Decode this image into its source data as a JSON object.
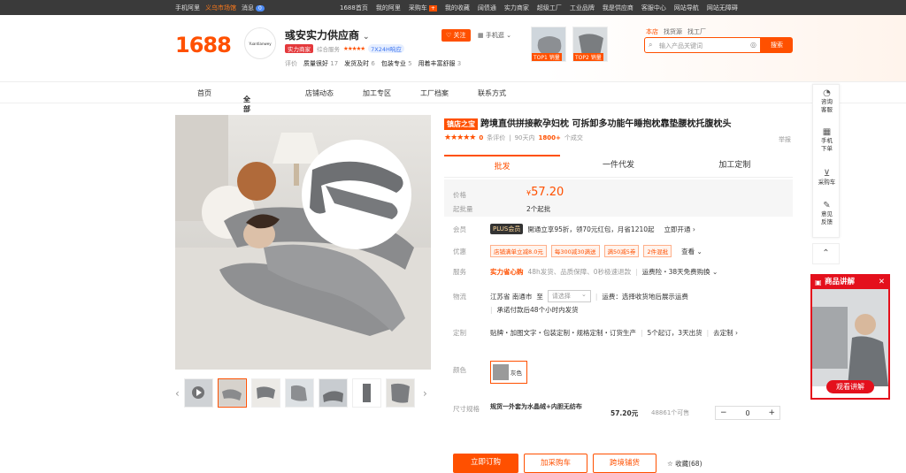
{
  "topbar": {
    "mobile": "手机阿里",
    "market": "义乌市场馆",
    "message": "消息",
    "msg_count": "0",
    "links": [
      "1688首页",
      "我的阿里",
      "采购车",
      "我的收藏",
      "阔债通",
      "实力商家",
      "超级工厂",
      "工业品牌",
      "我是供应商",
      "客服中心",
      "网站导航",
      "网站无障碍"
    ],
    "cart_badge": "+"
  },
  "header": {
    "logo": "1688",
    "shop_logo_text": "Yuantianwey",
    "shop_name": "彧安实力供应商",
    "tag_strength": "实力商家",
    "tag_service": "综合服务",
    "stars": "★★★★★",
    "tag_24h": "7X24H响应",
    "rating_label": "评价",
    "ratings": [
      {
        "label": "质量很好",
        "value": "17"
      },
      {
        "label": "发货及时",
        "value": "6"
      },
      {
        "label": "包装专业",
        "value": "5"
      },
      {
        "label": "用着丰富舒服",
        "value": "3"
      }
    ],
    "follow": "关注",
    "mobile_store": "手机逛",
    "top1": "TOP1",
    "top1_label": "销量",
    "top2": "TOP2",
    "top2_label": "销量"
  },
  "search": {
    "tabs": [
      "本店",
      "找货源",
      "找工厂"
    ],
    "placeholder": "输入产品关键词",
    "button": "搜索"
  },
  "nav": {
    "items": [
      "首页",
      "全部商品",
      "店铺动态",
      "加工专区",
      "工厂档案",
      "联系方式"
    ]
  },
  "product": {
    "shop_tag": "镇店之宝",
    "title": "跨境直供拼接款孕妇枕 可拆卸多功能午睡抱枕靠垫腰枕托腹枕头",
    "stars": "★★★★★",
    "reviews_count": "0",
    "reviews_label": "条评价",
    "sales_period": "90天内",
    "sales_count": "1800+",
    "sales_unit": "个成交",
    "report": "举报",
    "tabs": [
      "批发",
      "一件代发",
      "加工定制"
    ],
    "price_label": "价格",
    "currency": "¥",
    "price": "57.20",
    "moq_label": "起批量",
    "moq": "2个起批"
  },
  "details": {
    "member_label": "会员",
    "plus": "PLUS会员",
    "member_text": "開通立享95折，领70元红包，月省1210起",
    "member_link": "立即开通 ›",
    "promo_label": "优惠",
    "coupons": [
      "店铺满单立减8.0元",
      "每300减30满送",
      "满50减5券",
      "2件混批"
    ],
    "view": "查看 ⌄",
    "service_label": "服务",
    "service_highlight": "实力省心购",
    "service_text": "48h发货、品质保障、0秒极速退款",
    "service_freight": "运费险・38天免费购换 ⌄",
    "logistics_label": "物流",
    "ship_from": "江苏省 南通市",
    "to": "至",
    "select_placeholder": "请选择",
    "freight": "运费：选择收货地后展示运费",
    "ship_promise": "承诺付款后48个小时内发货",
    "custom_label": "定制",
    "custom_text": "贴牌・加图文字・包装定制・规格定制・订货生产",
    "custom_min": "5个起订，3天出货",
    "custom_link": "去定制 ›",
    "color_label": "颜色",
    "color_value": "灰色",
    "size_label": "尺寸规格",
    "size_name": "规货一外套为水晶绒+内胆无纺布",
    "size_price": "57.20元",
    "size_stock": "48861个可售",
    "qty": "0"
  },
  "actions": {
    "buy": "立即订购",
    "cart": "加采购车",
    "cross": "跨境铺货",
    "fav": "☆ 收藏(68)"
  },
  "sidebar": {
    "items": [
      "咨询客服",
      "手机下单",
      "采购车",
      "意见反馈"
    ]
  },
  "live": {
    "title": "商品讲解",
    "button": "观看讲解"
  }
}
